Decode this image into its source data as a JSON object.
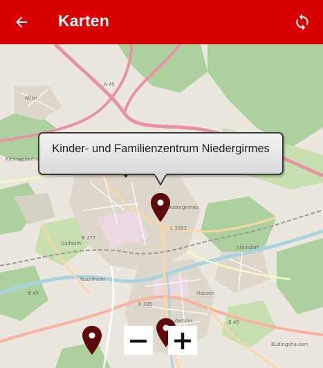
{
  "header": {
    "title": "Karten",
    "back_icon": "arrow-back-icon",
    "refresh_icon": "sync-icon",
    "color": "#d80000"
  },
  "map": {
    "places": {
      "albar": "Aßlar",
      "kleinwesten": "Kleinweisseneck",
      "dalheim": "Dalheim",
      "niedergirmes": "Niedergirmes",
      "wetzlar": "Wetzlar",
      "steindorf": "Steindorf",
      "hausen": "Hausen",
      "buedingshausen": "Büdingshausen",
      "naunheim": "Naunheim"
    },
    "road_labels": {
      "b49a": "B 49",
      "b49b": "B 49",
      "a45": "A 45",
      "b277": "B 277",
      "l3053": "L 3053",
      "k395": "K 395"
    },
    "popup": {
      "text": "Kinder- und Familienzentrum Niedergirmes"
    },
    "marker_color": "#5c0a0a"
  },
  "zoom": {
    "out_label": "−",
    "in_label": "+"
  }
}
